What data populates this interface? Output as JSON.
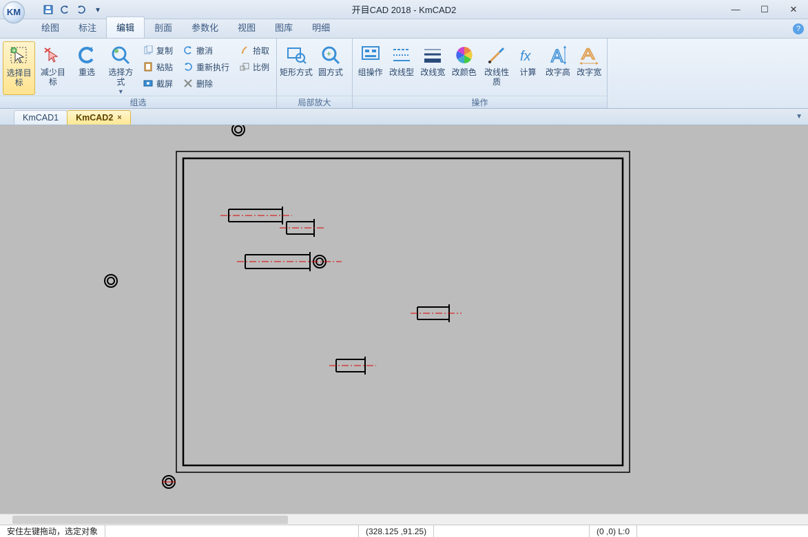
{
  "title": "开目CAD 2018 - KmCAD2",
  "app_icon_text": "KM",
  "menu": {
    "items": [
      "绘图",
      "标注",
      "编辑",
      "剖面",
      "参数化",
      "视图",
      "图库",
      "明细"
    ],
    "active_index": 2
  },
  "ribbon": {
    "groups": [
      {
        "label": "组选",
        "big": [
          {
            "name": "select-target",
            "label": "选择目标",
            "highlight": true
          },
          {
            "name": "decrease-target",
            "label": "减少目标"
          },
          {
            "name": "reselect",
            "label": "重选"
          },
          {
            "name": "select-mode",
            "label": "选择方式"
          }
        ],
        "small": [
          {
            "name": "copy",
            "label": "复制"
          },
          {
            "name": "paste",
            "label": "粘贴"
          },
          {
            "name": "screenshot",
            "label": "截屏"
          },
          {
            "name": "undo",
            "label": "撤消"
          },
          {
            "name": "redo",
            "label": "重新执行"
          },
          {
            "name": "delete",
            "label": "删除"
          },
          {
            "name": "pick",
            "label": "拾取"
          },
          {
            "name": "scale",
            "label": "比例"
          }
        ]
      },
      {
        "label": "局部放大",
        "big": [
          {
            "name": "zoom-rect",
            "label": "矩形方式"
          },
          {
            "name": "zoom-circle",
            "label": "圆方式"
          }
        ]
      },
      {
        "label": "操作",
        "big": [
          {
            "name": "group-op",
            "label": "组操作"
          },
          {
            "name": "line-style",
            "label": "改线型"
          },
          {
            "name": "line-width",
            "label": "改线宽"
          },
          {
            "name": "color",
            "label": "改颜色"
          },
          {
            "name": "line-props",
            "label": "改线性质"
          },
          {
            "name": "calculate",
            "label": "计算"
          },
          {
            "name": "text-height",
            "label": "改字高"
          },
          {
            "name": "text-width",
            "label": "改字宽"
          }
        ]
      }
    ]
  },
  "tabs": {
    "items": [
      "KmCAD1",
      "KmCAD2"
    ],
    "active_index": 1
  },
  "status": {
    "hint": "安住左键拖动，选定对象",
    "coord": "(328.125 ,91.25)",
    "layer": "(0 ,0) L:0"
  }
}
